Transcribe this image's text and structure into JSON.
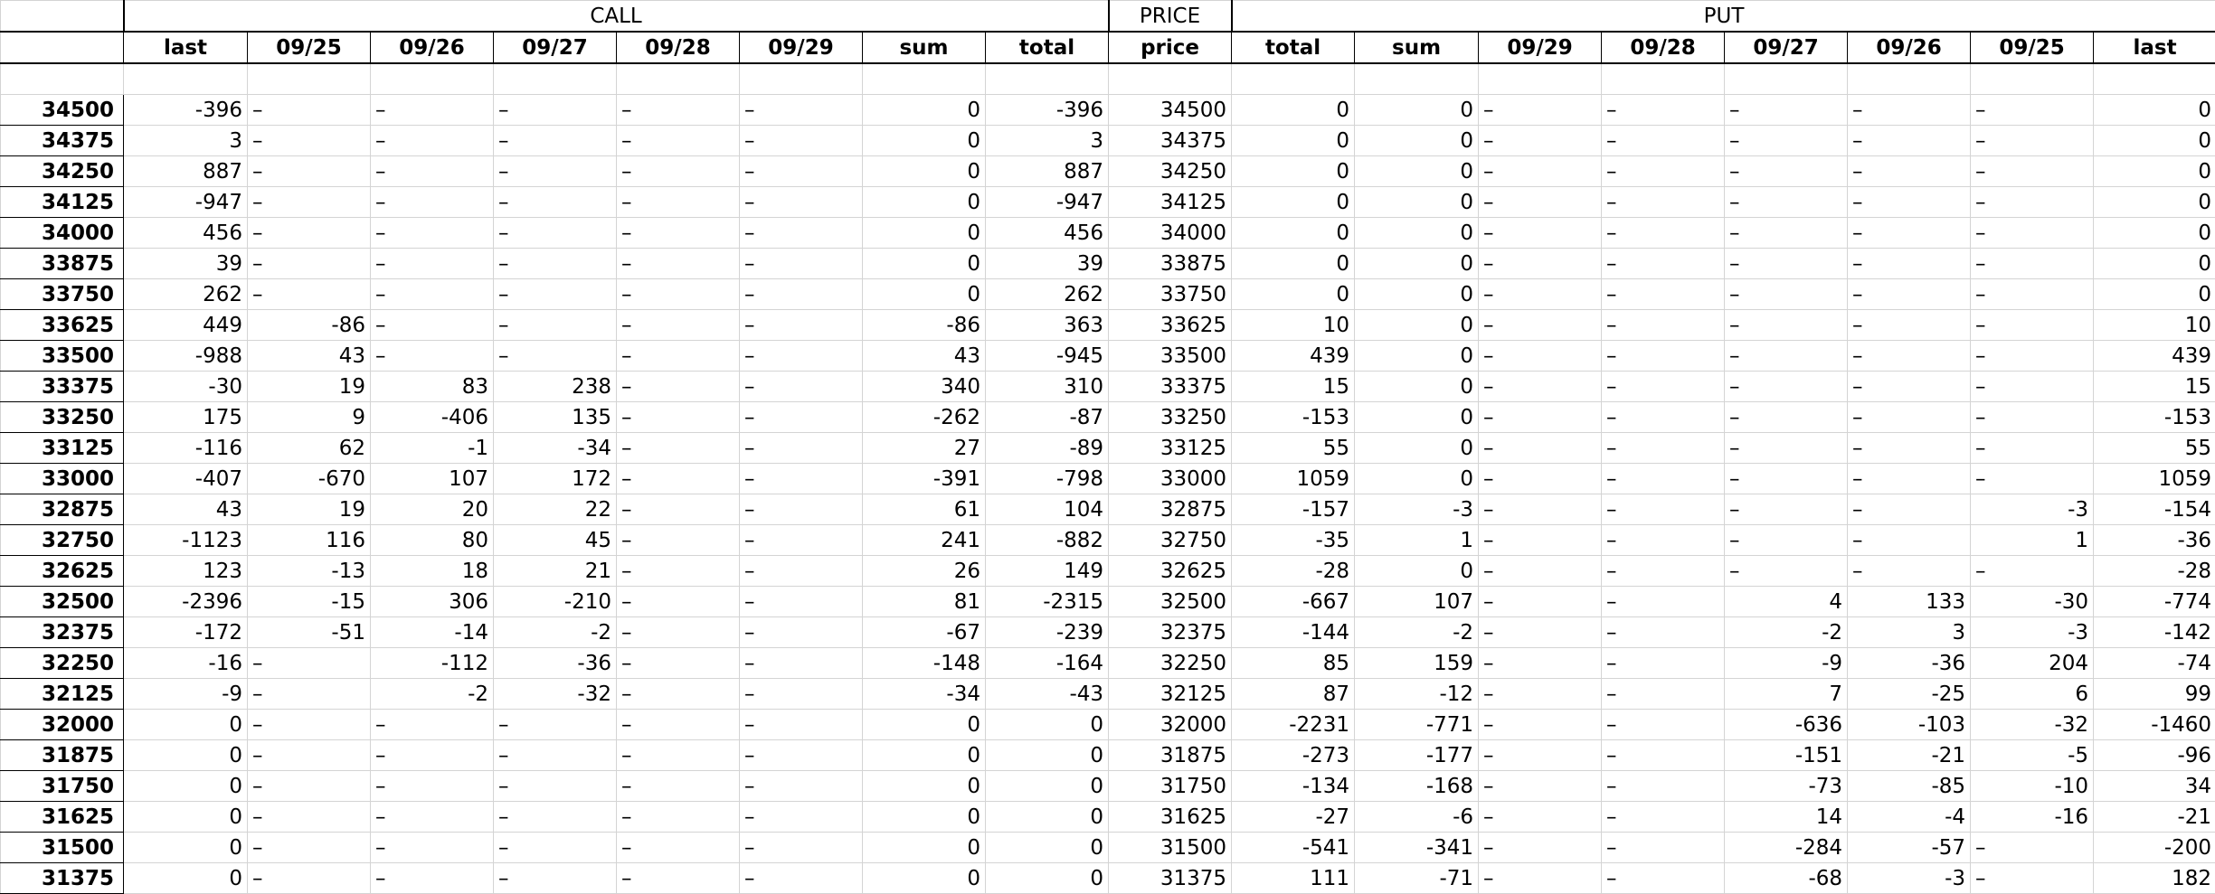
{
  "groups": {
    "call": "CALL",
    "price": "PRICE",
    "put": "PUT"
  },
  "columns": [
    "last",
    "09/25",
    "09/26",
    "09/27",
    "09/28",
    "09/29",
    "sum",
    "total",
    "price",
    "total",
    "sum",
    "09/29",
    "09/28",
    "09/27",
    "09/26",
    "09/25",
    "last"
  ],
  "rows": [
    [
      "34500",
      "-396",
      "–",
      "–",
      "–",
      "–",
      "–",
      "0",
      "-396",
      "34500",
      "0",
      "0",
      "–",
      "–",
      "–",
      "–",
      "–",
      "0"
    ],
    [
      "34375",
      "3",
      "–",
      "–",
      "–",
      "–",
      "–",
      "0",
      "3",
      "34375",
      "0",
      "0",
      "–",
      "–",
      "–",
      "–",
      "–",
      "0"
    ],
    [
      "34250",
      "887",
      "–",
      "–",
      "–",
      "–",
      "–",
      "0",
      "887",
      "34250",
      "0",
      "0",
      "–",
      "–",
      "–",
      "–",
      "–",
      "0"
    ],
    [
      "34125",
      "-947",
      "–",
      "–",
      "–",
      "–",
      "–",
      "0",
      "-947",
      "34125",
      "0",
      "0",
      "–",
      "–",
      "–",
      "–",
      "–",
      "0"
    ],
    [
      "34000",
      "456",
      "–",
      "–",
      "–",
      "–",
      "–",
      "0",
      "456",
      "34000",
      "0",
      "0",
      "–",
      "–",
      "–",
      "–",
      "–",
      "0"
    ],
    [
      "33875",
      "39",
      "–",
      "–",
      "–",
      "–",
      "–",
      "0",
      "39",
      "33875",
      "0",
      "0",
      "–",
      "–",
      "–",
      "–",
      "–",
      "0"
    ],
    [
      "33750",
      "262",
      "–",
      "–",
      "–",
      "–",
      "–",
      "0",
      "262",
      "33750",
      "0",
      "0",
      "–",
      "–",
      "–",
      "–",
      "–",
      "0"
    ],
    [
      "33625",
      "449",
      "-86",
      "–",
      "–",
      "–",
      "–",
      "-86",
      "363",
      "33625",
      "10",
      "0",
      "–",
      "–",
      "–",
      "–",
      "–",
      "10"
    ],
    [
      "33500",
      "-988",
      "43",
      "–",
      "–",
      "–",
      "–",
      "43",
      "-945",
      "33500",
      "439",
      "0",
      "–",
      "–",
      "–",
      "–",
      "–",
      "439"
    ],
    [
      "33375",
      "-30",
      "19",
      "83",
      "238",
      "–",
      "–",
      "340",
      "310",
      "33375",
      "15",
      "0",
      "–",
      "–",
      "–",
      "–",
      "–",
      "15"
    ],
    [
      "33250",
      "175",
      "9",
      "-406",
      "135",
      "–",
      "–",
      "-262",
      "-87",
      "33250",
      "-153",
      "0",
      "–",
      "–",
      "–",
      "–",
      "–",
      "-153"
    ],
    [
      "33125",
      "-116",
      "62",
      "-1",
      "-34",
      "–",
      "–",
      "27",
      "-89",
      "33125",
      "55",
      "0",
      "–",
      "–",
      "–",
      "–",
      "–",
      "55"
    ],
    [
      "33000",
      "-407",
      "-670",
      "107",
      "172",
      "–",
      "–",
      "-391",
      "-798",
      "33000",
      "1059",
      "0",
      "–",
      "–",
      "–",
      "–",
      "–",
      "1059"
    ],
    [
      "32875",
      "43",
      "19",
      "20",
      "22",
      "–",
      "–",
      "61",
      "104",
      "32875",
      "-157",
      "-3",
      "–",
      "–",
      "–",
      "–",
      "-3",
      "-154"
    ],
    [
      "32750",
      "-1123",
      "116",
      "80",
      "45",
      "–",
      "–",
      "241",
      "-882",
      "32750",
      "-35",
      "1",
      "–",
      "–",
      "–",
      "–",
      "1",
      "-36"
    ],
    [
      "32625",
      "123",
      "-13",
      "18",
      "21",
      "–",
      "–",
      "26",
      "149",
      "32625",
      "-28",
      "0",
      "–",
      "–",
      "–",
      "–",
      "–",
      "-28"
    ],
    [
      "32500",
      "-2396",
      "-15",
      "306",
      "-210",
      "–",
      "–",
      "81",
      "-2315",
      "32500",
      "-667",
      "107",
      "–",
      "–",
      "4",
      "133",
      "-30",
      "-774"
    ],
    [
      "32375",
      "-172",
      "-51",
      "-14",
      "-2",
      "–",
      "–",
      "-67",
      "-239",
      "32375",
      "-144",
      "-2",
      "–",
      "–",
      "-2",
      "3",
      "-3",
      "-142"
    ],
    [
      "32250",
      "-16",
      "–",
      "-112",
      "-36",
      "–",
      "–",
      "-148",
      "-164",
      "32250",
      "85",
      "159",
      "–",
      "–",
      "-9",
      "-36",
      "204",
      "-74"
    ],
    [
      "32125",
      "-9",
      "–",
      "-2",
      "-32",
      "–",
      "–",
      "-34",
      "-43",
      "32125",
      "87",
      "-12",
      "–",
      "–",
      "7",
      "-25",
      "6",
      "99"
    ],
    [
      "32000",
      "0",
      "–",
      "–",
      "–",
      "–",
      "–",
      "0",
      "0",
      "32000",
      "-2231",
      "-771",
      "–",
      "–",
      "-636",
      "-103",
      "-32",
      "-1460"
    ],
    [
      "31875",
      "0",
      "–",
      "–",
      "–",
      "–",
      "–",
      "0",
      "0",
      "31875",
      "-273",
      "-177",
      "–",
      "–",
      "-151",
      "-21",
      "-5",
      "-96"
    ],
    [
      "31750",
      "0",
      "–",
      "–",
      "–",
      "–",
      "–",
      "0",
      "0",
      "31750",
      "-134",
      "-168",
      "–",
      "–",
      "-73",
      "-85",
      "-10",
      "34"
    ],
    [
      "31625",
      "0",
      "–",
      "–",
      "–",
      "–",
      "–",
      "0",
      "0",
      "31625",
      "-27",
      "-6",
      "–",
      "–",
      "14",
      "-4",
      "-16",
      "-21"
    ],
    [
      "31500",
      "0",
      "–",
      "–",
      "–",
      "–",
      "–",
      "0",
      "0",
      "31500",
      "-541",
      "-341",
      "–",
      "–",
      "-284",
      "-57",
      "–",
      "-200"
    ],
    [
      "31375",
      "0",
      "–",
      "–",
      "–",
      "–",
      "–",
      "0",
      "0",
      "31375",
      "111",
      "-71",
      "–",
      "–",
      "-68",
      "-3",
      "–",
      "182"
    ]
  ]
}
